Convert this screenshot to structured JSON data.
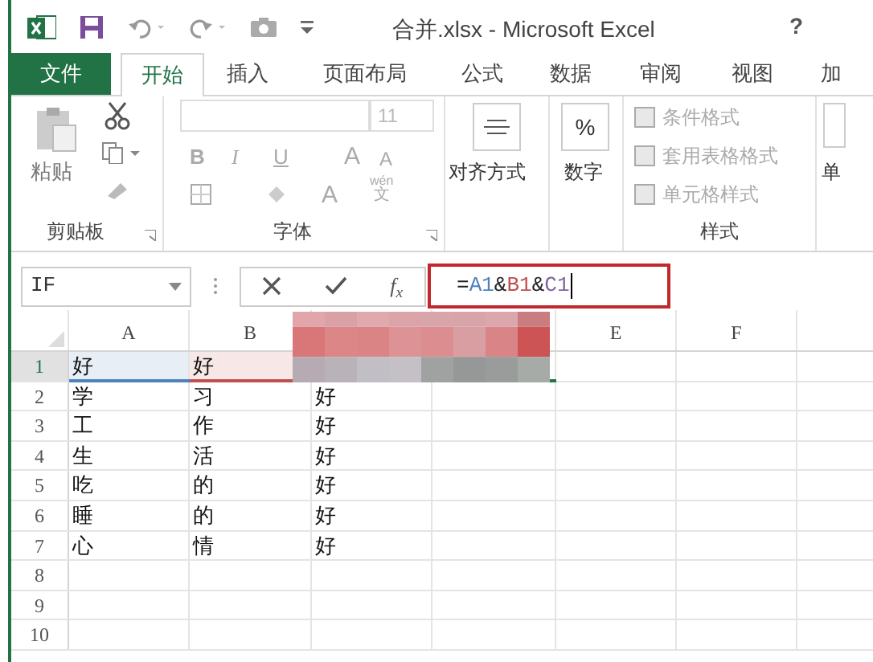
{
  "title_bar": {
    "title": "合并.xlsx - Microsoft Excel",
    "help": "?"
  },
  "tabs": [
    {
      "label": "文件",
      "kind": "file",
      "selected": false
    },
    {
      "label": "开始",
      "kind": "tab",
      "selected": true
    },
    {
      "label": "插入",
      "kind": "tab",
      "selected": false
    },
    {
      "label": "页面布局",
      "kind": "tab",
      "selected": false
    },
    {
      "label": "公式",
      "kind": "tab",
      "selected": false
    },
    {
      "label": "数据",
      "kind": "tab",
      "selected": false
    },
    {
      "label": "审阅",
      "kind": "tab",
      "selected": false
    },
    {
      "label": "视图",
      "kind": "tab",
      "selected": false
    },
    {
      "label": "加",
      "kind": "tab",
      "selected": false
    }
  ],
  "ribbon": {
    "clipboard": {
      "paste": "粘贴",
      "label": "剪贴板"
    },
    "font": {
      "size": "11",
      "format_buttons": [
        "B",
        "I",
        "U"
      ],
      "size_buttons": [
        "A",
        "A"
      ],
      "font_color": "A",
      "phonetic": [
        "wén",
        "文"
      ],
      "label": "字体"
    },
    "alignment": {
      "label": "对齐方式"
    },
    "number": {
      "symbol": "%",
      "label": "数字"
    },
    "styles": {
      "items": [
        "条件格式",
        "套用表格格式",
        "单元格样式"
      ],
      "label": "样式"
    },
    "cells": {
      "label": "单"
    }
  },
  "formula_bar": {
    "name_box": "IF",
    "function_button": "f$_{x}$",
    "tokens": [
      {
        "text": "="
      },
      {
        "text": "A1",
        "color": "#4f81bd"
      },
      {
        "text": "&"
      },
      {
        "text": "B1",
        "color": "#c0504d"
      },
      {
        "text": "&"
      },
      {
        "text": "C1",
        "color": "#8064a2"
      }
    ]
  },
  "column_headers": [
    "A",
    "B",
    "E",
    "F"
  ],
  "rows": [
    {
      "number": "1",
      "selected": true,
      "cells": [
        "好",
        "好"
      ]
    },
    {
      "number": "2",
      "selected": false,
      "cells": [
        "学",
        "习",
        "好"
      ]
    },
    {
      "number": "3",
      "selected": false,
      "cells": [
        "工",
        "作",
        "好"
      ]
    },
    {
      "number": "4",
      "selected": false,
      "cells": [
        "生",
        "活",
        "好"
      ]
    },
    {
      "number": "5",
      "selected": false,
      "cells": [
        "吃",
        "的",
        "好"
      ]
    },
    {
      "number": "6",
      "selected": false,
      "cells": [
        "睡",
        "的",
        "好"
      ]
    },
    {
      "number": "7",
      "selected": false,
      "cells": [
        "心",
        "情",
        "好"
      ]
    },
    {
      "number": "8",
      "selected": false,
      "cells": []
    },
    {
      "number": "9",
      "selected": false,
      "cells": []
    },
    {
      "number": "10",
      "selected": false,
      "cells": []
    }
  ]
}
